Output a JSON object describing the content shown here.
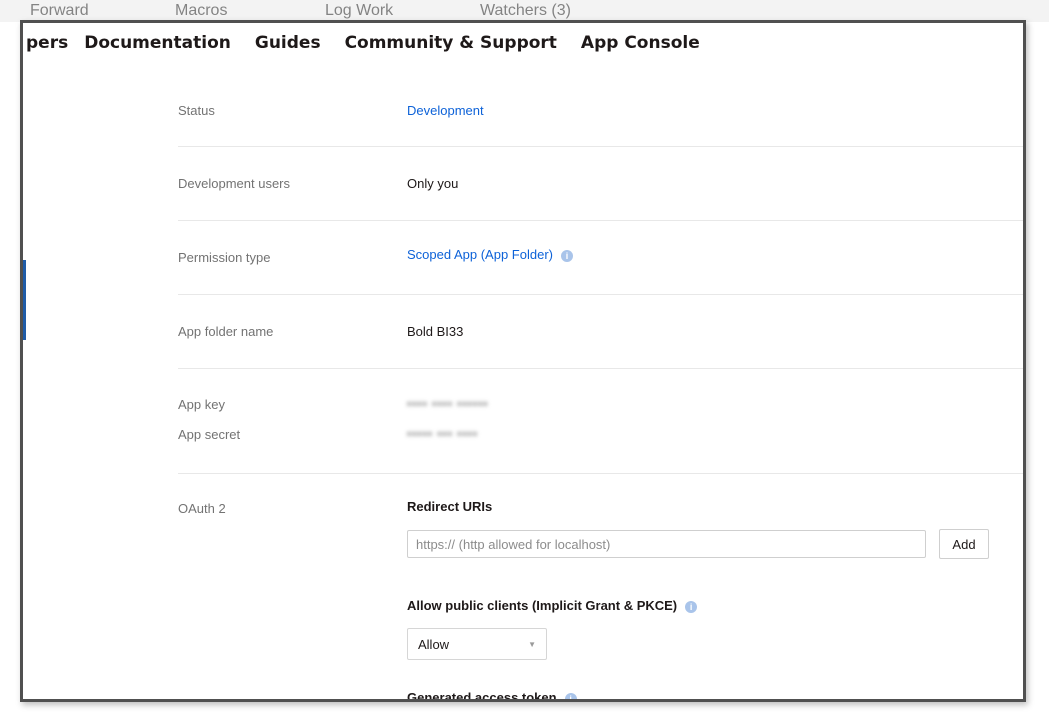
{
  "backdrop": {
    "items": [
      "Forward",
      "Macros",
      "Log Work",
      "Watchers (3)"
    ]
  },
  "nav": {
    "items": [
      "pers",
      "Documentation",
      "Guides",
      "Community & Support",
      "App Console"
    ]
  },
  "settings": {
    "status": {
      "label": "Status",
      "value": "Development"
    },
    "dev_users": {
      "label": "Development users",
      "value": "Only you"
    },
    "permission_type": {
      "label": "Permission type",
      "value": "Scoped App (App Folder)"
    },
    "app_folder_name": {
      "label": "App folder name",
      "value": "Bold BI33"
    },
    "app_key": {
      "label": "App key",
      "value": "•••• •••• ••••••"
    },
    "app_secret": {
      "label": "App secret",
      "value": "••••• ••• ••••"
    },
    "oauth": {
      "label": "OAuth 2",
      "redirect_title": "Redirect URIs",
      "redirect_placeholder": "https:// (http allowed for localhost)",
      "add_label": "Add",
      "public_clients_title": "Allow public clients (Implicit Grant & PKCE)",
      "public_clients_value": "Allow",
      "access_token_title": "Generated access token"
    }
  },
  "colors": {
    "link": "#0d62d8",
    "info_icon": "#a9c4ea",
    "text": "#1e1919",
    "label": "#737373"
  },
  "icons": {
    "info": "info-circle-icon",
    "dropdown": "chevron-down-icon"
  }
}
